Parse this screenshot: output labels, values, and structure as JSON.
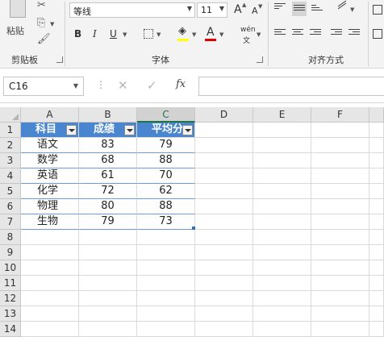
{
  "ribbon": {
    "clipboard": {
      "paste_label": "粘贴",
      "group_label": "剪贴板"
    },
    "font": {
      "font_name": "等线",
      "font_size": "11",
      "grow_label": "A",
      "shrink_label": "A",
      "bold_label": "B",
      "italic_label": "I",
      "underline_label": "U",
      "font_color_label": "A",
      "phonetic_top": "wén",
      "phonetic_bottom": "文",
      "group_label": "字体",
      "highlight_color": "#ffff00",
      "font_color": "#e00000"
    },
    "alignment": {
      "group_label": "对齐方式"
    }
  },
  "formula_bar": {
    "name_box": "C16",
    "cancel_icon": "✕",
    "enter_icon": "✓",
    "fx_label": "fx",
    "formula": ""
  },
  "sheet": {
    "columns": [
      "A",
      "B",
      "C",
      "D",
      "E",
      "F"
    ],
    "active_column": "C",
    "rows": [
      "1",
      "2",
      "3",
      "4",
      "5",
      "6",
      "7",
      "8",
      "9",
      "10",
      "11",
      "12",
      "13",
      "14"
    ],
    "table": {
      "header_color": "#4a86d0",
      "headers": [
        "科目",
        "成绩",
        "平均分"
      ],
      "data": [
        [
          "语文",
          "83",
          "79"
        ],
        [
          "数学",
          "68",
          "88"
        ],
        [
          "英语",
          "61",
          "70"
        ],
        [
          "化学",
          "72",
          "62"
        ],
        [
          "物理",
          "80",
          "88"
        ],
        [
          "生物",
          "79",
          "73"
        ]
      ]
    }
  }
}
